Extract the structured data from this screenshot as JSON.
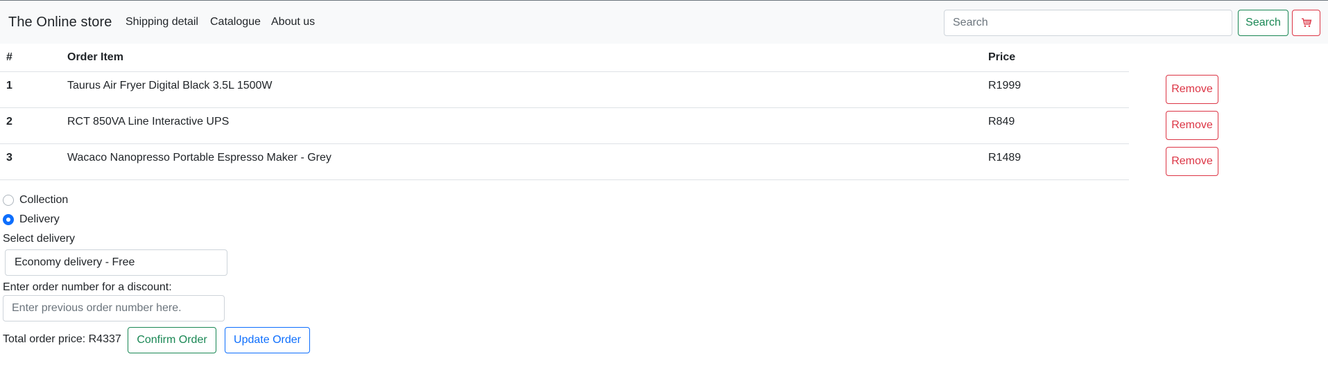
{
  "navbar": {
    "brand": "The Online store",
    "links": [
      "Shipping detail",
      "Catalogue",
      "About us"
    ],
    "search_placeholder": "Search",
    "search_button": "Search",
    "cart_icon": "cart-icon"
  },
  "table": {
    "headers": {
      "num": "#",
      "item": "Order Item",
      "price": "Price"
    },
    "rows": [
      {
        "num": "1",
        "item": "Taurus Air Fryer Digital Black 3.5L 1500W",
        "price": "R1999",
        "action": "Remove"
      },
      {
        "num": "2",
        "item": "RCT 850VA Line Interactive UPS",
        "price": "R849",
        "action": "Remove"
      },
      {
        "num": "3",
        "item": "Wacaco Nanopresso Portable Espresso Maker - Grey",
        "price": "R1489",
        "action": "Remove"
      }
    ]
  },
  "delivery": {
    "options": [
      {
        "label": "Collection",
        "checked": false
      },
      {
        "label": "Delivery",
        "checked": true
      }
    ],
    "select_label": "Select delivery",
    "select_value": "Economy delivery - Free"
  },
  "discount": {
    "label": "Enter order number for a discount:",
    "placeholder": "Enter previous order number here."
  },
  "footer": {
    "total": "Total order price: R4337",
    "confirm_button": "Confirm Order",
    "update_button": "Update Order"
  },
  "colors": {
    "success": "#198754",
    "danger": "#dc3545",
    "primary": "#0d6efd",
    "navbar_bg": "#f8f9fa"
  }
}
